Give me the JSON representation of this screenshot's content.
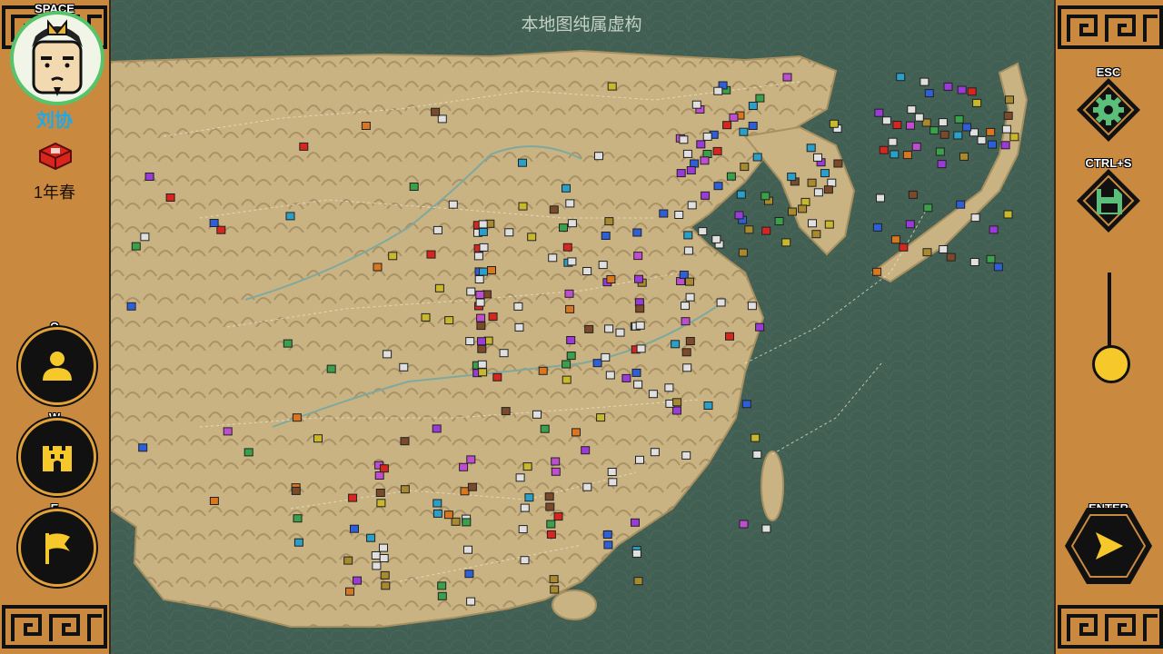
{
  "header": {
    "notice": "本地图纯属虚构"
  },
  "left_panel": {
    "avatar_key": "SPACE",
    "ruler_name": "刘协",
    "season": "1年春",
    "buttons": [
      {
        "key": "Q",
        "icon": "person-icon"
      },
      {
        "key": "W",
        "icon": "castle-icon"
      },
      {
        "key": "E",
        "icon": "flag-icon"
      }
    ]
  },
  "right_panel": {
    "settings_key": "ESC",
    "save_key": "CTRL+S",
    "end_turn_key": "ENTER",
    "zoom_level": 0.1
  },
  "colors": {
    "panel": "#c98a3f",
    "sea": "#415f52",
    "land": "#c9b383",
    "accent_yellow": "#f7c82a",
    "ruler_blue": "#1fa8e8",
    "player_red": "#d8261e"
  }
}
